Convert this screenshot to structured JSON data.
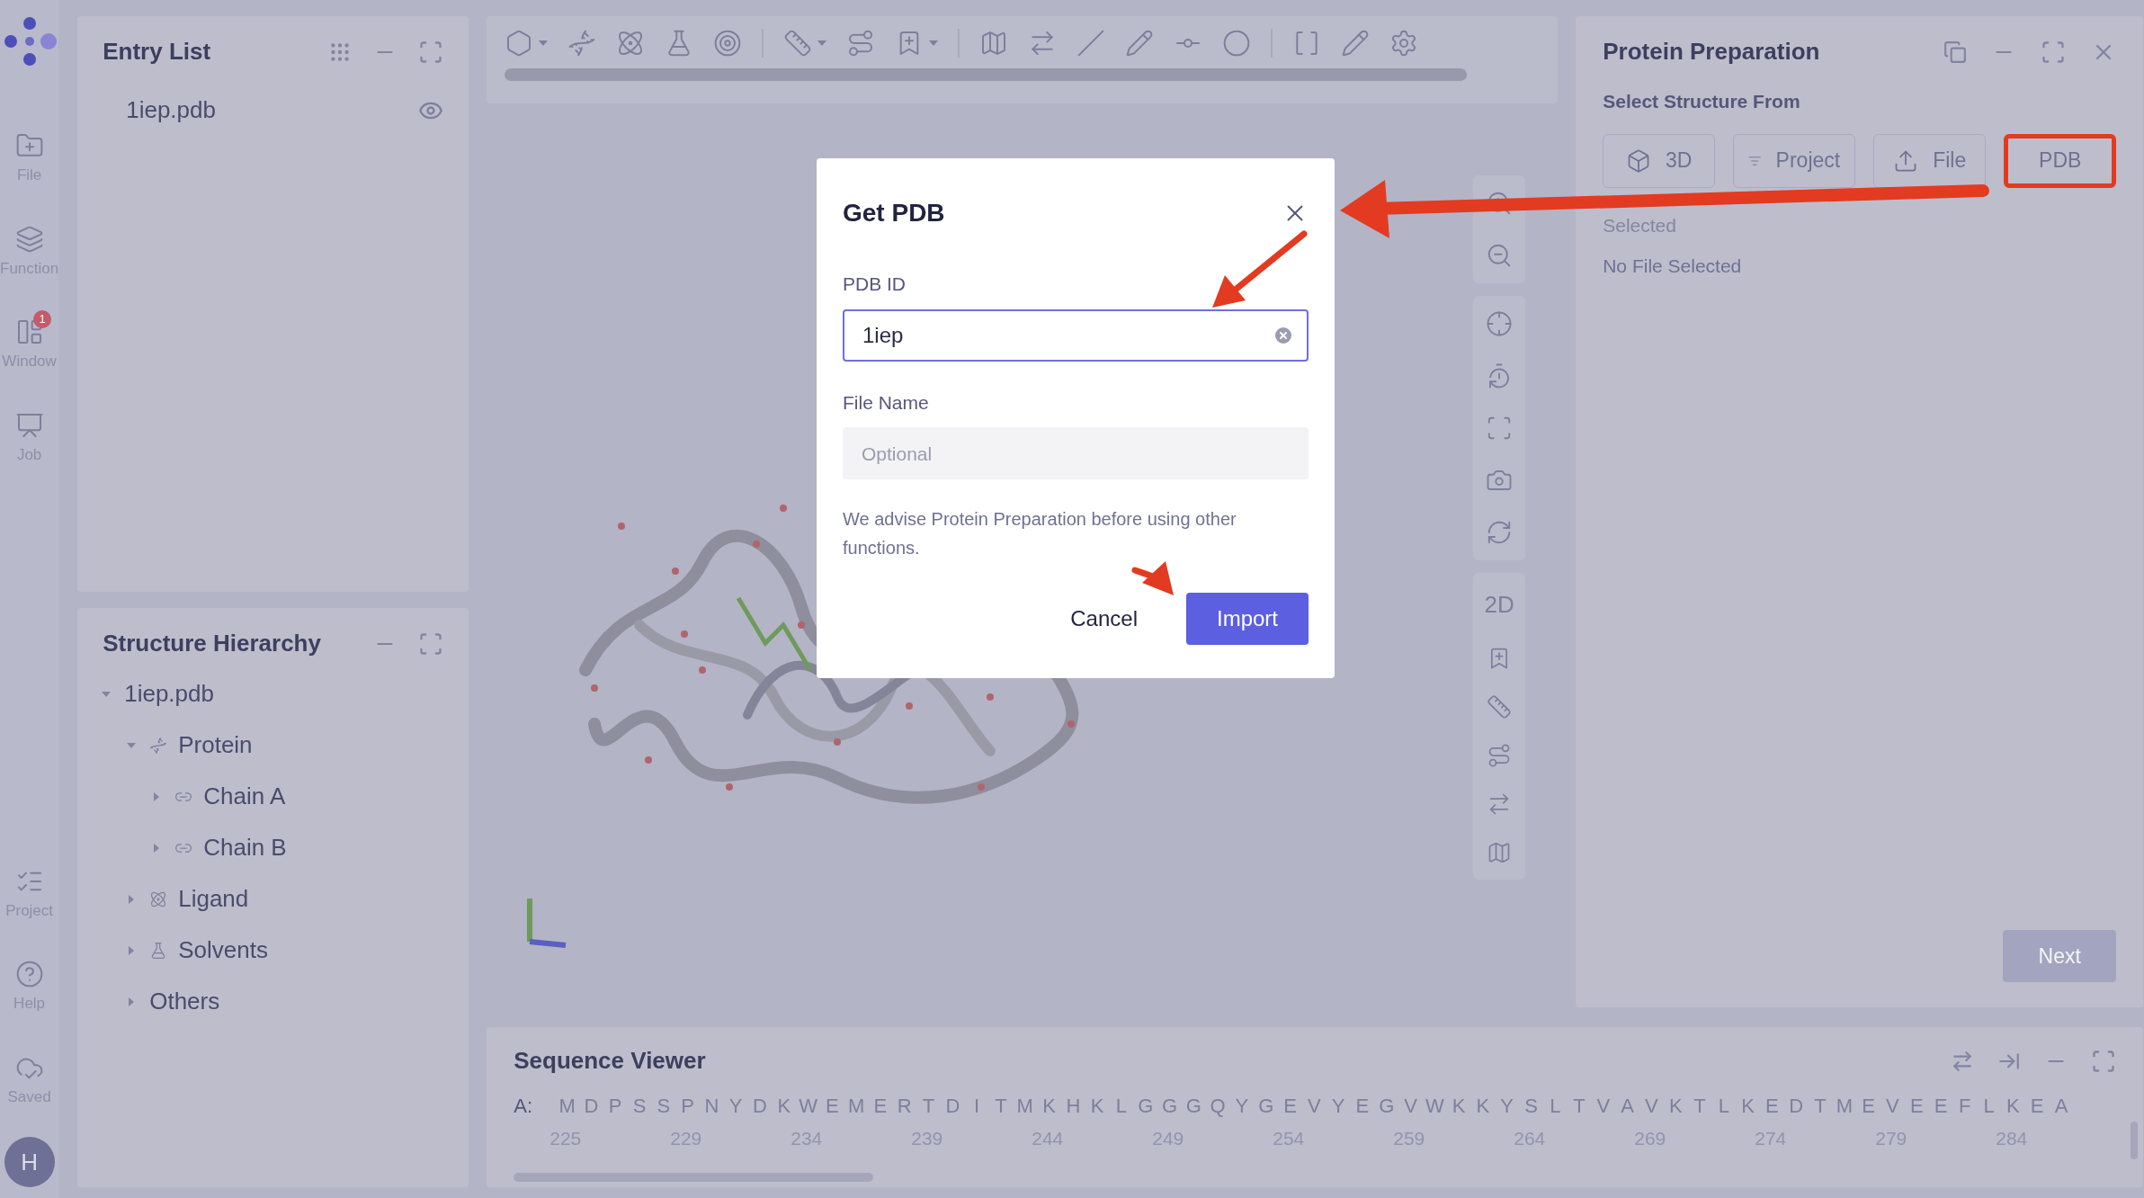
{
  "rail": {
    "items": [
      {
        "label": "File",
        "kind": "file"
      },
      {
        "label": "Function",
        "kind": "function"
      },
      {
        "label": "Window",
        "kind": "window",
        "badge": "1"
      },
      {
        "label": "Job",
        "kind": "job"
      }
    ],
    "bottom_items": [
      {
        "label": "Project",
        "kind": "project"
      },
      {
        "label": "Help",
        "kind": "help"
      },
      {
        "label": "Saved",
        "kind": "saved"
      }
    ],
    "avatar": "H"
  },
  "entry_list": {
    "title": "Entry List",
    "items": [
      {
        "label": "1iep.pdb",
        "visible": true
      }
    ]
  },
  "structure_hierarchy": {
    "title": "Structure Hierarchy",
    "tree": [
      {
        "label": "1iep.pdb",
        "expanded": true,
        "children": [
          {
            "label": "Protein",
            "kind": "protein",
            "expanded": true,
            "children": [
              {
                "label": "Chain A",
                "kind": "chain",
                "expanded": false
              },
              {
                "label": "Chain B",
                "kind": "chain",
                "expanded": false
              }
            ]
          },
          {
            "label": "Ligand",
            "kind": "ligand",
            "expanded": false
          },
          {
            "label": "Solvents",
            "kind": "solvent",
            "expanded": false
          },
          {
            "label": "Others",
            "expanded": false
          }
        ]
      }
    ]
  },
  "viewer": {
    "side_toolbar_label": "2D"
  },
  "protein_preparation": {
    "title": "Protein Preparation",
    "subtitle": "Select Structure From",
    "sources": [
      {
        "label": "3D",
        "kind": "scene",
        "highlighted": false
      },
      {
        "label": "Project",
        "kind": "project",
        "highlighted": false
      },
      {
        "label": "File",
        "kind": "file",
        "highlighted": false
      },
      {
        "label": "PDB",
        "kind": "pdb",
        "highlighted": true
      }
    ],
    "selected_label": "Selected",
    "selected_value": "No File Selected",
    "next_button": {
      "label": "Next",
      "disabled": true
    }
  },
  "sequence_viewer": {
    "title": "Sequence Viewer",
    "rows": [
      {
        "chain": "A:",
        "residues": [
          "M",
          "D",
          "P",
          "S",
          "S",
          "P",
          "N",
          "Y",
          "D",
          "K",
          "W",
          "E",
          "M",
          "E",
          "R",
          "T",
          "D",
          "I",
          "T",
          "M",
          "K",
          "H",
          "K",
          "L",
          "G",
          "G",
          "G",
          "Q",
          "Y",
          "G",
          "E",
          "V",
          "Y",
          "E",
          "G",
          "V",
          "W",
          "K",
          "K",
          "Y",
          "S",
          "L",
          "T",
          "V",
          "A",
          "V",
          "K",
          "T",
          "L",
          "K",
          "E",
          "D",
          "T",
          "M",
          "E",
          "V",
          "E",
          "E",
          "F",
          "L",
          "K",
          "E",
          "A"
        ],
        "numbers": [
          "225",
          "229",
          "234",
          "239",
          "244",
          "249",
          "254",
          "259",
          "264",
          "269",
          "274",
          "279",
          "284"
        ]
      }
    ]
  },
  "dialog": {
    "title": "Get PDB",
    "fields": [
      {
        "label": "PDB ID",
        "value": "1iep",
        "focused": true
      },
      {
        "label": "File Name",
        "placeholder": "Optional",
        "focused": false
      }
    ],
    "note": "We advise Protein Preparation before using other functions.",
    "buttons": [
      {
        "label": "Cancel",
        "kind": "secondary"
      },
      {
        "label": "Import",
        "kind": "primary"
      }
    ]
  }
}
